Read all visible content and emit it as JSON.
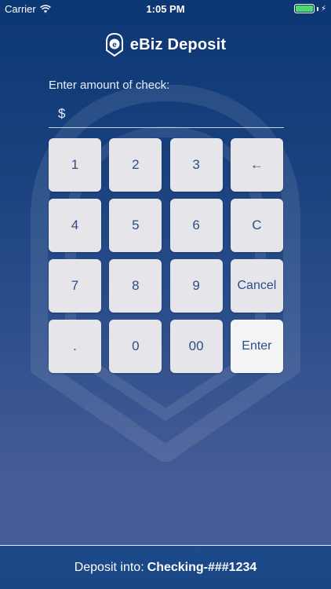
{
  "status_bar": {
    "carrier": "Carrier",
    "time": "1:05 PM",
    "battery_level": 1.0,
    "icons": [
      "wifi-icon",
      "battery-icon",
      "charging-bolt-icon"
    ]
  },
  "header": {
    "title": "eBiz Deposit",
    "logo_letter": "e",
    "logo_icon": "ebiz-shield-logo-icon"
  },
  "amount": {
    "label": "Enter amount of check:",
    "currency_symbol": "$",
    "value": ""
  },
  "keypad": {
    "keys": [
      "1",
      "2",
      "3",
      "←",
      "4",
      "5",
      "6",
      "C",
      "7",
      "8",
      "9",
      "Cancel",
      ".",
      "0",
      "00",
      "Enter"
    ]
  },
  "footer": {
    "prefix": "Deposit into:",
    "account": "Checking-###1234"
  },
  "colors": {
    "background_top": "#0d3774",
    "background_bottom": "#4a5e98",
    "key_background": "#e6e6ea",
    "key_text": "#2c4e85",
    "enter_key_background": "#f4f4f6",
    "battery_fill": "#4cd964"
  }
}
